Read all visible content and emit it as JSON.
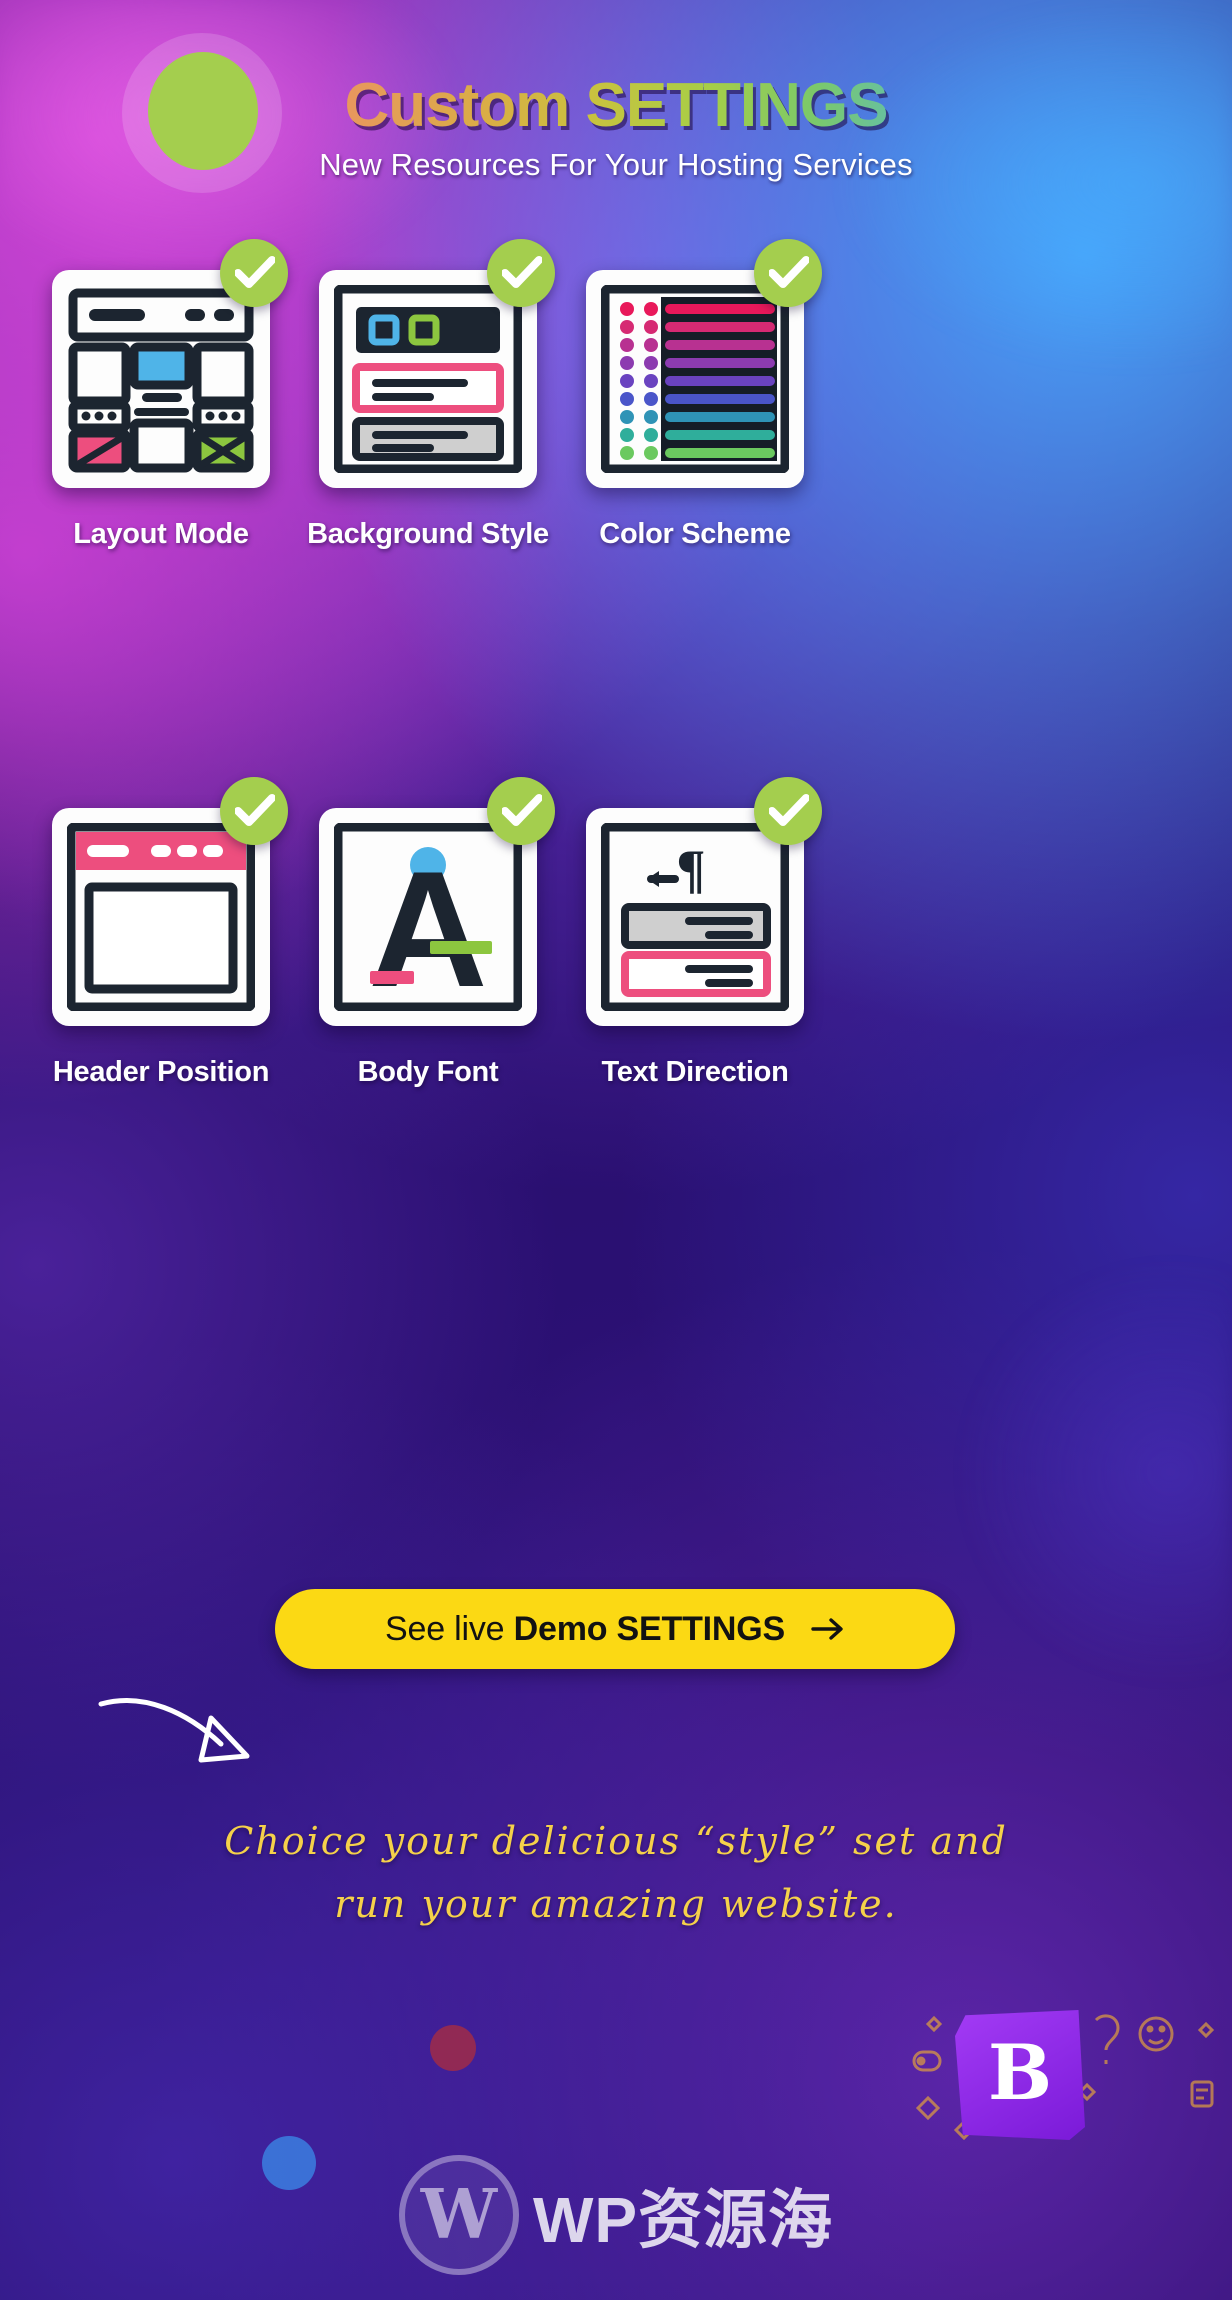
{
  "header": {
    "title_part1": "Custom ",
    "title_part2": "SETTINGS",
    "subtitle": "New Resources For Your Hosting Services"
  },
  "cards": [
    {
      "label": "Layout Mode",
      "icon": "layout-mode-icon",
      "checked": true
    },
    {
      "label": "Background Style",
      "icon": "background-style-icon",
      "checked": true
    },
    {
      "label": "Color Scheme",
      "icon": "color-scheme-icon",
      "checked": true
    },
    {
      "label": "Header Position",
      "icon": "header-position-icon",
      "checked": true
    },
    {
      "label": "Body Font",
      "icon": "body-font-icon",
      "checked": true,
      "glyph": "A"
    },
    {
      "label": "Text Direction",
      "icon": "text-direction-icon",
      "checked": true,
      "glyph": "¶"
    }
  ],
  "cta": {
    "text_normal": "See live ",
    "text_bold": "Demo SETTINGS",
    "arrow": "arrow-right-icon"
  },
  "script_note": {
    "line1": "Choice your delicious “style” set and",
    "line2": "run your amazing website."
  },
  "watermark": {
    "mark": "W",
    "text": "WP资源海"
  },
  "sticker": {
    "letter": "B"
  },
  "colors": {
    "check_green": "#a4ce4e",
    "ink": "#1c2530",
    "pink": "#ed4e7e",
    "blue": "#4fb4e8",
    "green": "#8cc63f",
    "cta_yellow": "#fbd914",
    "script_yellow": "#f5d14a",
    "card_white": "#fdfdfd"
  },
  "color_scheme_swatches": [
    "#e8185a",
    "#d62a73",
    "#b83191",
    "#8c3bb0",
    "#6a43c0",
    "#4a55c9",
    "#3a74c4",
    "#2f93b6",
    "#2fae9b",
    "#47c07c",
    "#6bc95f"
  ]
}
